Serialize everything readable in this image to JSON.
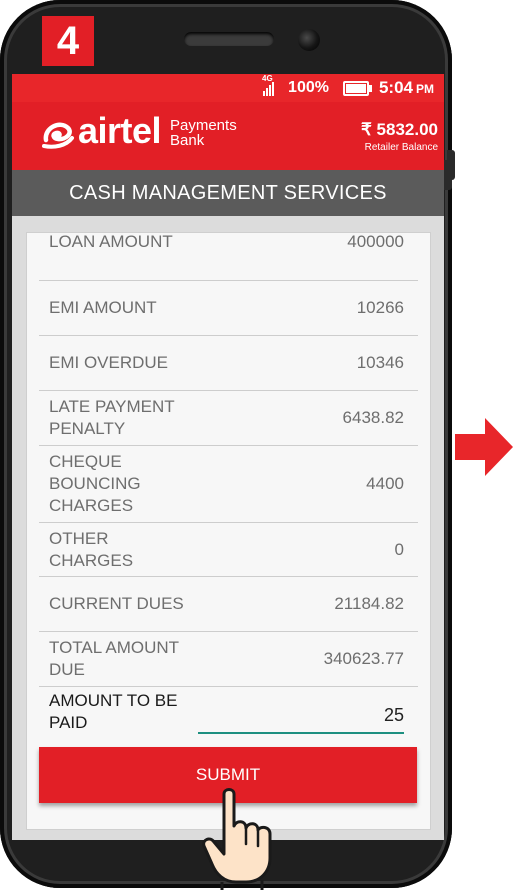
{
  "step": "4",
  "status_bar": {
    "network": "4G",
    "battery": "100%",
    "time": "5:04",
    "ampm": "PM"
  },
  "brand": {
    "name": "airtel",
    "line1": "Payments",
    "line2": "Bank"
  },
  "balance": {
    "amount": "₹ 5832.00",
    "label": "Retailer Balance"
  },
  "screen_title": "CASH MANAGEMENT SERVICES",
  "rows": [
    {
      "label": "LOAN AMOUNT",
      "value": "400000"
    },
    {
      "label": "EMI AMOUNT",
      "value": "10266"
    },
    {
      "label": "EMI OVERDUE",
      "value": "10346"
    },
    {
      "label": "LATE PAYMENT PENALTY",
      "value": "6438.82"
    },
    {
      "label": "CHEQUE BOUNCING CHARGES",
      "value": "4400"
    },
    {
      "label": "OTHER CHARGES",
      "value": "0"
    },
    {
      "label": "CURRENT DUES",
      "value": "21184.82"
    },
    {
      "label": "TOTAL AMOUNT DUE",
      "value": "340623.77"
    }
  ],
  "payment": {
    "label": "AMOUNT TO BE PAID",
    "value": "25"
  },
  "submit_label": "SUBMIT",
  "colors": {
    "brand_red": "#e21f26",
    "header_gray": "#5b5b5b",
    "input_underline": "#1d8f80"
  }
}
